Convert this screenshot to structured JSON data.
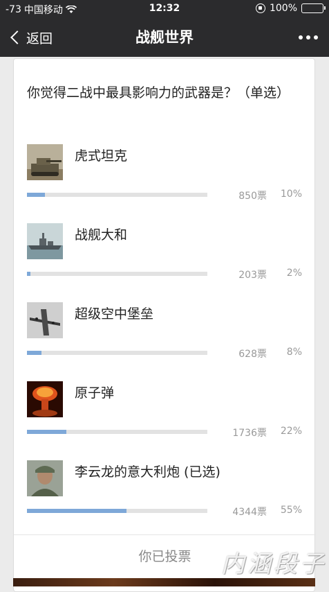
{
  "status_bar": {
    "signal": "-73",
    "carrier": "中国移动",
    "time": "12:32",
    "battery": "100%"
  },
  "nav": {
    "back_label": "返回",
    "title": "战舰世界"
  },
  "poll": {
    "question": "你觉得二战中最具影响力的武器是？（单选）",
    "options": [
      {
        "label": "虎式坦克",
        "votes": "850票",
        "percent": "10%",
        "share": 0.1,
        "thumb_icon": "tiger-tank-photo"
      },
      {
        "label": "战舰大和",
        "votes": "203票",
        "percent": "2%",
        "share": 0.02,
        "thumb_icon": "battleship-yamato-photo"
      },
      {
        "label": "超级空中堡垒",
        "votes": "628票",
        "percent": "8%",
        "share": 0.08,
        "thumb_icon": "b29-bomber-photo"
      },
      {
        "label": "原子弹",
        "votes": "1736票",
        "percent": "22%",
        "share": 0.22,
        "thumb_icon": "mushroom-cloud-photo"
      },
      {
        "label": "李云龙的意大利炮 (已选)",
        "votes": "4344票",
        "percent": "55%",
        "share": 0.55,
        "thumb_icon": "soldier-portrait-photo"
      }
    ],
    "footer": "你已投票"
  },
  "watermark": "内涵段子",
  "colors": {
    "bar_fill": "#7ea8d8",
    "bar_track": "#e2e2e2",
    "nav_bg": "#2b2b2d"
  }
}
